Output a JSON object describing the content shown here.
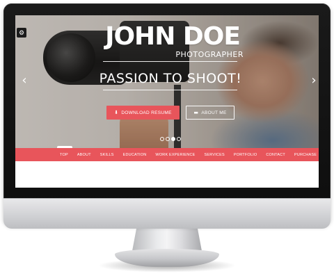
{
  "hero": {
    "title": "JOHN DOE",
    "subtitle": "PHOTOGRAPHER",
    "tagline": "PASSION TO SHOOT!",
    "download_label": "DOWNLOAD RESUME",
    "about_label": "ABOUT ME",
    "download_icon": "download-icon",
    "about_icon": "id-card-icon",
    "slides_total": 4,
    "slide_active": 3
  },
  "controls": {
    "settings_icon": "gear-icon",
    "prev_icon": "chevron-left-icon",
    "next_icon": "chevron-right-icon"
  },
  "nav": {
    "items": [
      "TOP",
      "ABOUT",
      "SKILLS",
      "EDUCATION",
      "WORK EXPERIENCE",
      "SERVICES",
      "PORTFOLIO",
      "CONTACT",
      "PURCHASE"
    ]
  },
  "colors": {
    "accent": "#e8555b",
    "text_on_hero": "#ffffff"
  }
}
